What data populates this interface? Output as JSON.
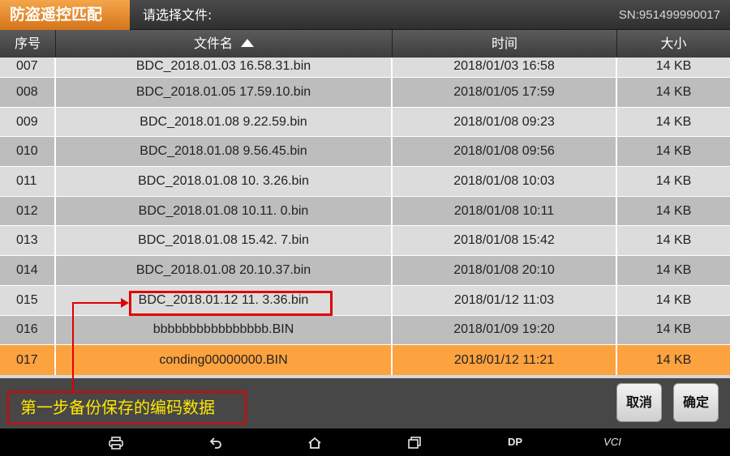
{
  "titlebar": {
    "app_title": "防盗遥控匹配",
    "prompt": "请选择文件:",
    "serial": "SN:951499990017"
  },
  "table": {
    "columns": [
      "序号",
      "文件名",
      "时间",
      "大小"
    ],
    "sort_column": "文件名",
    "sort_direction": "ascending",
    "rows": [
      {
        "index": "007",
        "filename": "BDC_2018.01.03 16.58.31.bin",
        "time": "2018/01/03 16:58",
        "size": "14 KB"
      },
      {
        "index": "008",
        "filename": "BDC_2018.01.05 17.59.10.bin",
        "time": "2018/01/05 17:59",
        "size": "14 KB"
      },
      {
        "index": "009",
        "filename": "BDC_2018.01.08  9.22.59.bin",
        "time": "2018/01/08 09:23",
        "size": "14 KB"
      },
      {
        "index": "010",
        "filename": "BDC_2018.01.08  9.56.45.bin",
        "time": "2018/01/08 09:56",
        "size": "14 KB"
      },
      {
        "index": "011",
        "filename": "BDC_2018.01.08 10. 3.26.bin",
        "time": "2018/01/08 10:03",
        "size": "14 KB"
      },
      {
        "index": "012",
        "filename": "BDC_2018.01.08 10.11. 0.bin",
        "time": "2018/01/08 10:11",
        "size": "14 KB"
      },
      {
        "index": "013",
        "filename": "BDC_2018.01.08 15.42. 7.bin",
        "time": "2018/01/08 15:42",
        "size": "14 KB"
      },
      {
        "index": "014",
        "filename": "BDC_2018.01.08 20.10.37.bin",
        "time": "2018/01/08 20:10",
        "size": "14 KB"
      },
      {
        "index": "015",
        "filename": "BDC_2018.01.12 11. 3.36.bin",
        "time": "2018/01/12 11:03",
        "size": "14 KB"
      },
      {
        "index": "016",
        "filename": "bbbbbbbbbbbbbbbb.BIN",
        "time": "2018/01/09 19:20",
        "size": "14 KB"
      },
      {
        "index": "017",
        "filename": "conding00000000.BIN",
        "time": "2018/01/12 11:21",
        "size": "14 KB"
      }
    ],
    "selected_index": "017"
  },
  "buttons": {
    "cancel": "取消",
    "ok": "确定"
  },
  "annotation": {
    "note": "第一步备份保存的编码数据",
    "highlighted_row": "015",
    "color": "#e10000",
    "text_color": "#ffe600"
  },
  "navbar": {
    "print_icon": "printer-icon",
    "back_icon": "back-arrow-icon",
    "home_icon": "home-icon",
    "recent_icon": "recent-apps-icon",
    "dp_label": "DP",
    "vci_label": "VCI"
  },
  "colors": {
    "accent": "#f4a64a",
    "selected_row": "#fca23f",
    "row_light": "#dcdcdc",
    "row_dark": "#bdbdbd"
  }
}
